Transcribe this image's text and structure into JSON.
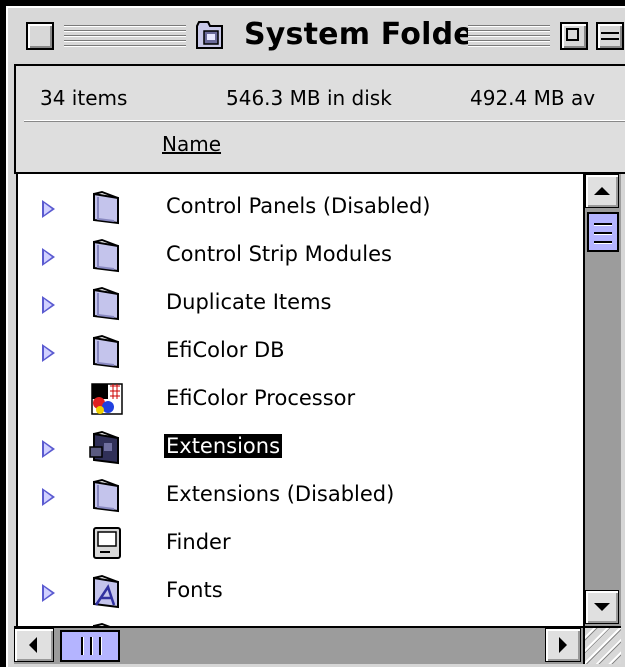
{
  "window": {
    "title": "System Folder",
    "title_icon": "system-folder-icon"
  },
  "header": {
    "item_count": "34 items",
    "disk_used": "546.3 MB in disk",
    "available": "492.4 MB av",
    "column_name": "Name"
  },
  "rows": [
    {
      "label": "Control Panels (Disabled)",
      "icon": "folder-icon",
      "expandable": true,
      "selected": false
    },
    {
      "label": "Control Strip Modules",
      "icon": "folder-icon",
      "expandable": true,
      "selected": false
    },
    {
      "label": "Duplicate Items",
      "icon": "folder-icon",
      "expandable": true,
      "selected": false
    },
    {
      "label": "EfiColor DB",
      "icon": "folder-icon",
      "expandable": true,
      "selected": false
    },
    {
      "label": "EfiColor Processor",
      "icon": "color-processor-icon",
      "expandable": false,
      "selected": false
    },
    {
      "label": "Extensions",
      "icon": "extensions-folder-icon",
      "expandable": true,
      "selected": true
    },
    {
      "label": "Extensions (Disabled)",
      "icon": "folder-icon",
      "expandable": true,
      "selected": false
    },
    {
      "label": "Finder",
      "icon": "finder-icon",
      "expandable": false,
      "selected": false
    },
    {
      "label": "Fonts",
      "icon": "fonts-folder-icon",
      "expandable": true,
      "selected": false
    }
  ],
  "colors": {
    "selection": "#000000",
    "scroll_thumb": "#b4b4ff",
    "disclosure": "#5a5ad0"
  }
}
